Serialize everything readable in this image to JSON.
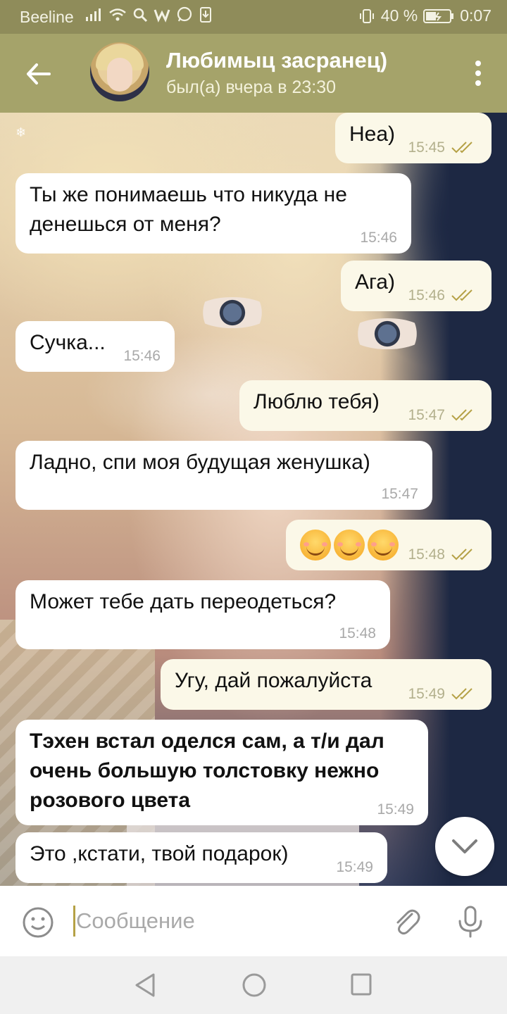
{
  "status_bar": {
    "carrier": "Beeline",
    "battery": "40 %",
    "time": "0:07",
    "icons": [
      "signal-icon",
      "wifi-icon",
      "search-icon",
      "w-icon",
      "whatsapp-icon",
      "download-icon",
      "vibrate-icon",
      "battery-icon"
    ]
  },
  "header": {
    "title": "Любимыц засранец)",
    "subtitle": "был(а) вчера в 23:30"
  },
  "messages": [
    {
      "dir": "out",
      "text": "Неа)",
      "time": "15:45"
    },
    {
      "dir": "in",
      "text": "Ты же понимаешь что никуда не денешься от меня?",
      "time": "15:46"
    },
    {
      "dir": "out",
      "text": "Ага)",
      "time": "15:46"
    },
    {
      "dir": "in",
      "text": "Сучка...",
      "time": "15:46"
    },
    {
      "dir": "out",
      "text": "Люблю тебя)",
      "time": "15:47"
    },
    {
      "dir": "in",
      "text": "Ладно, спи моя будущая женушка)",
      "time": "15:47"
    },
    {
      "dir": "out",
      "text": "☺☺☺",
      "time": "15:48"
    },
    {
      "dir": "in",
      "text": "Может тебе дать переодеться?",
      "time": "15:48"
    },
    {
      "dir": "out",
      "text": "Угу, дай пожалуйста",
      "time": "15:49"
    },
    {
      "dir": "in",
      "text": "Тэхен встал оделся сам, а т/и дал очень большую толстовку нежно розового цвета",
      "time": "15:49"
    },
    {
      "dir": "in",
      "text": "Это ,кстати, твой подарок)",
      "time": "15:49"
    }
  ],
  "input": {
    "placeholder": "Сообщение"
  },
  "colors": {
    "header": "#a5a36a",
    "status_bar": "#8f8c5a",
    "outgoing_bubble": "#fbf8e8",
    "incoming_bubble": "#ffffff",
    "read_check": "#b5a146"
  }
}
